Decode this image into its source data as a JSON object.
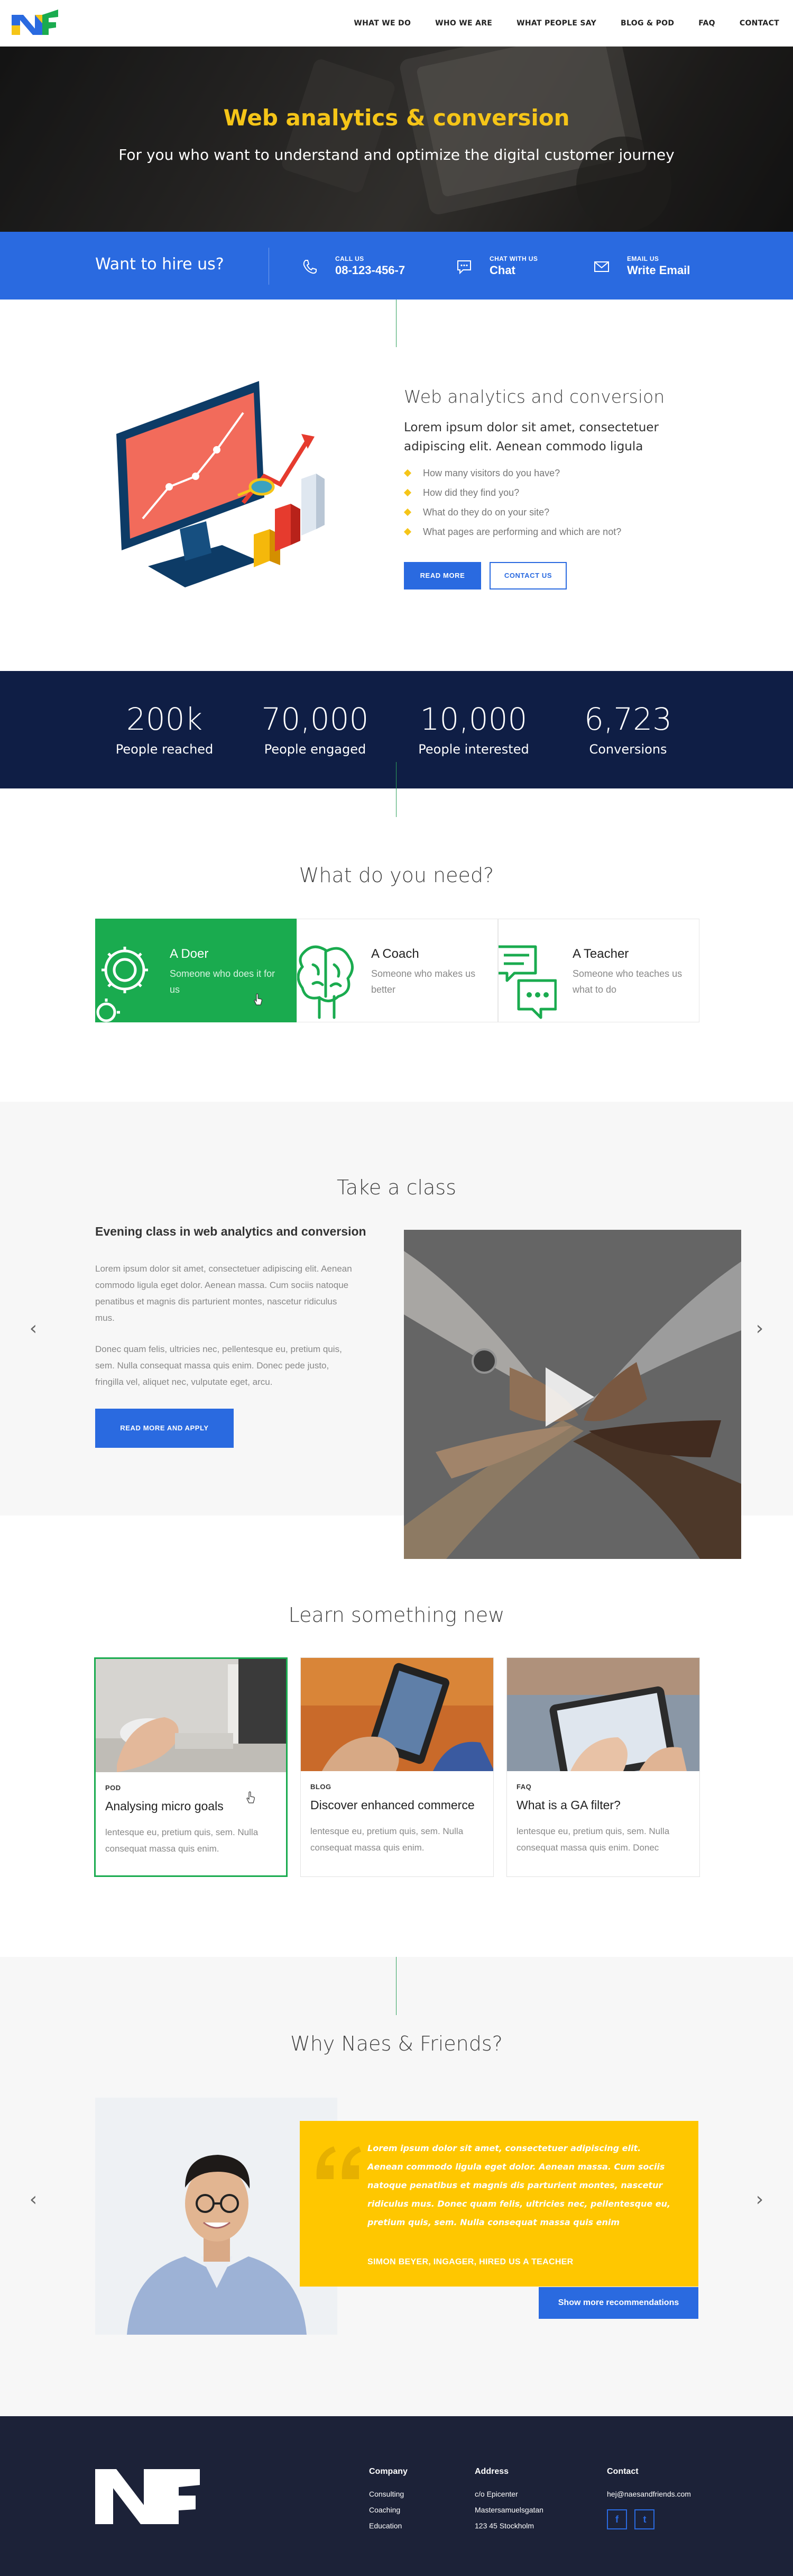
{
  "header": {
    "nav": [
      "WHAT WE DO",
      "WHO WE ARE",
      "WHAT PEOPLE SAY",
      "BLOG & POD",
      "FAQ",
      "CONTACT"
    ]
  },
  "hero": {
    "title": "Web analytics & conversion",
    "subtitle": "For you who want to understand and optimize the digital customer journey"
  },
  "hire": {
    "title": "Want to hire us?",
    "items": [
      {
        "label": "CALL US",
        "value": "08-123-456-7",
        "icon": "phone-icon"
      },
      {
        "label": "CHAT WITH US",
        "value": "Chat",
        "icon": "chat-icon"
      },
      {
        "label": "EMAIL US",
        "value": "Write Email",
        "icon": "mail-icon"
      }
    ]
  },
  "analytics": {
    "title": "Web analytics and conversion",
    "lead": "Lorem ipsum dolor sit amet, consectetuer adipiscing elit. Aenean commodo ligula",
    "list": [
      "How many visitors do you have?",
      "How did they find you?",
      "What do they do on your site?",
      "What pages are performing and which are not?"
    ],
    "read_more": "READ MORE",
    "contact_us": "CONTACT US"
  },
  "stats": [
    {
      "num": "200k",
      "label": "People reached"
    },
    {
      "num": "70,000",
      "label": "People engaged"
    },
    {
      "num": "10,000",
      "label": "People interested"
    },
    {
      "num": "6,723",
      "label": "Conversions"
    }
  ],
  "need": {
    "title": "What do you need?",
    "items": [
      {
        "title": "A Doer",
        "desc": "Someone who does it for us",
        "icon": "gear-icon"
      },
      {
        "title": "A Coach",
        "desc": "Someone who makes us better",
        "icon": "brain-icon"
      },
      {
        "title": "A Teacher",
        "desc": "Someone who teaches us what to do",
        "icon": "speech-bubble-icon"
      }
    ]
  },
  "class": {
    "title": "Take a class",
    "heading": "Evening class in web analytics and conversion",
    "p1": "Lorem ipsum dolor sit amet, consectetuer adipiscing elit. Aenean commodo ligula eget dolor. Aenean massa. Cum sociis natoque penatibus et magnis dis parturient montes, nascetur ridiculus mus.",
    "p2": "Donec quam felis, ultricies nec, pellentesque eu, pretium quis, sem. Nulla consequat massa quis enim. Donec pede justo, fringilla vel, aliquet nec, vulputate eget, arcu.",
    "button": "READ MORE AND APPLY"
  },
  "learn": {
    "title": "Learn something new",
    "cards": [
      {
        "cat": "POD",
        "title": "Analysing micro goals",
        "text": "lentesque eu, pretium quis, sem. Nulla consequat massa quis enim."
      },
      {
        "cat": "BLOG",
        "title": "Discover enhanced commerce",
        "text": "lentesque eu, pretium quis, sem. Nulla consequat massa quis enim."
      },
      {
        "cat": "FAQ",
        "title": "What is a GA filter?",
        "text": "lentesque eu, pretium quis, sem. Nulla consequat massa quis enim. Donec"
      }
    ]
  },
  "why": {
    "title": "Why Naes & Friends?",
    "quote": "Lorem ipsum dolor sit amet, consectetuer adipiscing elit. Aenean commodo ligula eget dolor. Aenean massa. Cum sociis natoque penatibus et magnis dis parturient montes, nascetur ridiculus mus. Donec quam felis, ultricies nec, pellentesque eu, pretium quis, sem. Nulla consequat massa quis enim",
    "author": "SIMON BEYER, INGAGER, HIRED US A TEACHER",
    "button": "Show more recommendations"
  },
  "footer": {
    "company": {
      "heading": "Company",
      "items": [
        "Consulting",
        "Coaching",
        "Education"
      ]
    },
    "address": {
      "heading": "Address",
      "items": [
        "c/o Epicenter",
        "Mastersamuelsgatan",
        "123 45 Stockholm"
      ]
    },
    "contact": {
      "heading": "Contact",
      "email": "hej@naesandfriends.com",
      "social": [
        "f",
        "t"
      ]
    }
  },
  "colors": {
    "brand_blue": "#2a6ae0",
    "brand_green": "#1aab4f",
    "brand_yellow": "#f5c518",
    "navy": "#0f1e45",
    "footer": "#1c2238"
  }
}
